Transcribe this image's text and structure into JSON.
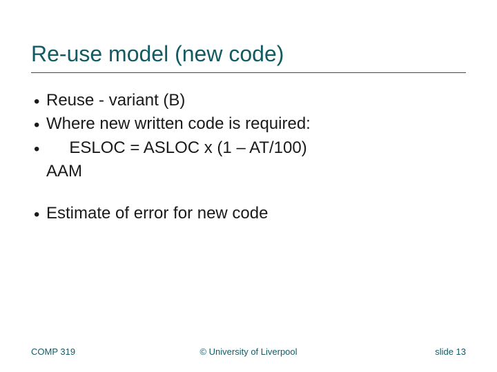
{
  "title": "Re-use model (new code)",
  "bullets_group1": [
    "Reuse  - variant (B)",
    "Where new written code is required:"
  ],
  "formula_line": "     ESLOC = ASLOC x (1 – AT/100)",
  "formula_wrap": "AAM",
  "bullets_group2": [
    "Estimate of error for new code"
  ],
  "footer": {
    "left": "COMP 319",
    "center": "© University of Liverpool",
    "right": "slide  13"
  }
}
